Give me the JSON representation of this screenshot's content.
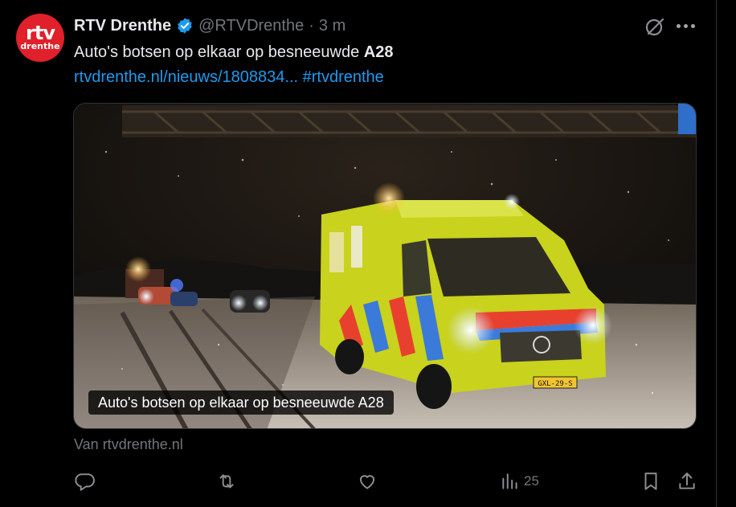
{
  "account": {
    "name": "RTV Drenthe",
    "handle": "@RTVDrenthe",
    "separator": "·",
    "time": "3 m",
    "avatar_top": "rtv",
    "avatar_sub": "drenthe",
    "verified_color": "#1d9bf0",
    "avatar_color": "#e0202a"
  },
  "tweet": {
    "text_before": "Auto's botsen op elkaar op besneeuwde ",
    "text_bold": "A28",
    "link_text": "rtvdrenthe.nl/nieuws/1808834... #rtvdrenthe",
    "link_color": "#1d9bf0"
  },
  "media": {
    "caption": "Auto's botsen op elkaar op besneeuwde A28",
    "source": "Van rtvdrenthe.nl",
    "plate": "GXL-29-S"
  },
  "actions": {
    "reply_icon": "reply-icon",
    "retweet_icon": "retweet-icon",
    "like_icon": "heart-icon",
    "views_icon": "views-icon",
    "views_count": "25",
    "bookmark_icon": "bookmark-icon",
    "share_icon": "share-icon"
  }
}
